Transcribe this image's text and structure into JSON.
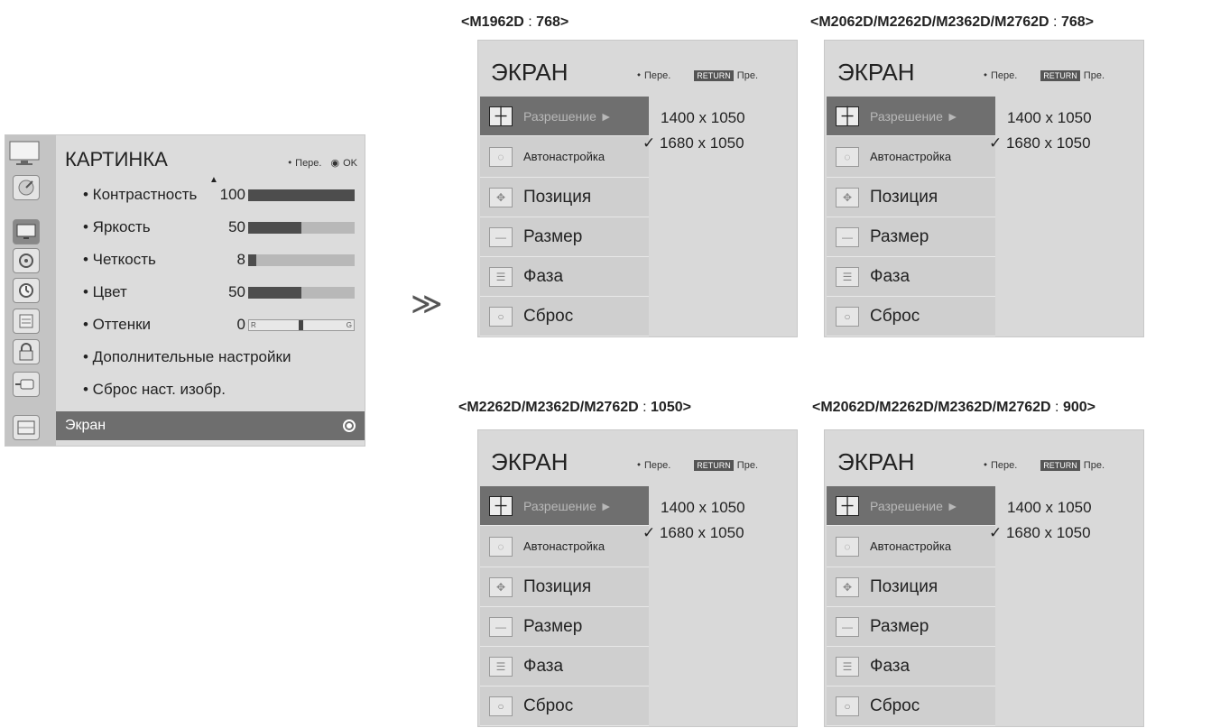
{
  "picture_menu": {
    "title": "КАРТИНКА",
    "hint_move": "Пере.",
    "hint_ok": "OK",
    "rows": [
      {
        "label": "• Контрастность",
        "value": "100",
        "level": 1.0
      },
      {
        "label": "• Яркость",
        "value": "50",
        "level": 0.5
      },
      {
        "label": "• Четкость",
        "value": "8",
        "level": 0.08
      },
      {
        "label": "• Цвет",
        "value": "50",
        "level": 0.5
      },
      {
        "label": "• Оттенки",
        "value": "0",
        "level": 0.5
      },
      {
        "label": "• Дополнительные настройки"
      },
      {
        "label": "• Сброс наст. изобр."
      }
    ],
    "tint_left": "R",
    "tint_right": "G",
    "footer": "Экран"
  },
  "panels": [
    {
      "caption_model": "<M1962D",
      "caption_sep": " : ",
      "caption_res": "768>"
    },
    {
      "caption_model": "<M2062D/M2262D/M2362D/M2762D",
      "caption_sep": " : ",
      "caption_res": "768>"
    },
    {
      "caption_model": "<M2262D/M2362D/M2762D",
      "caption_sep": " : ",
      "caption_res": "1050>"
    },
    {
      "caption_model": "<M2062D/M2262D/M2362D/M2762D",
      "caption_sep": " : ",
      "caption_res": "900>"
    }
  ],
  "screen_menu": {
    "title": "ЭКРАН",
    "hint_move": "Пере.",
    "return_badge": "RETURN",
    "hint_back": "Пре.",
    "items": [
      "Разрешение ►",
      "Автонастройка",
      "Позиция",
      "Размер",
      "Фаза",
      "Сброс"
    ],
    "options": [
      "1400 x 1050",
      "✓ 1680 x 1050"
    ]
  }
}
